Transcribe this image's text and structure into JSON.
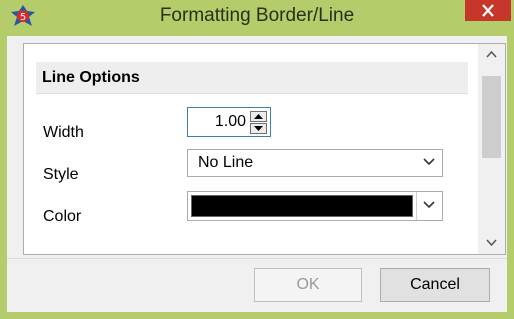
{
  "window": {
    "title": "Formatting Border/Line"
  },
  "panel": {
    "section_title": "Line Options",
    "width": {
      "label": "Width",
      "value": "1.00"
    },
    "style": {
      "label": "Style",
      "value": "No Line"
    },
    "color": {
      "label": "Color",
      "value": "#000000"
    }
  },
  "buttons": {
    "ok": "OK",
    "cancel": "Cancel"
  },
  "icons": {
    "app": "app-logo-icon",
    "close": "close-icon",
    "spin_up": "caret-up-icon",
    "spin_down": "caret-down-icon",
    "dropdown": "chevron-down-icon",
    "scroll_up": "chevron-up-icon",
    "scroll_down": "chevron-down-icon"
  },
  "colors": {
    "titlebar": "#b5cc6a",
    "close": "#c6362b",
    "dialog_bg": "#f0f0f0",
    "focus_border": "#3c7fb1",
    "swatch": "#000000"
  }
}
